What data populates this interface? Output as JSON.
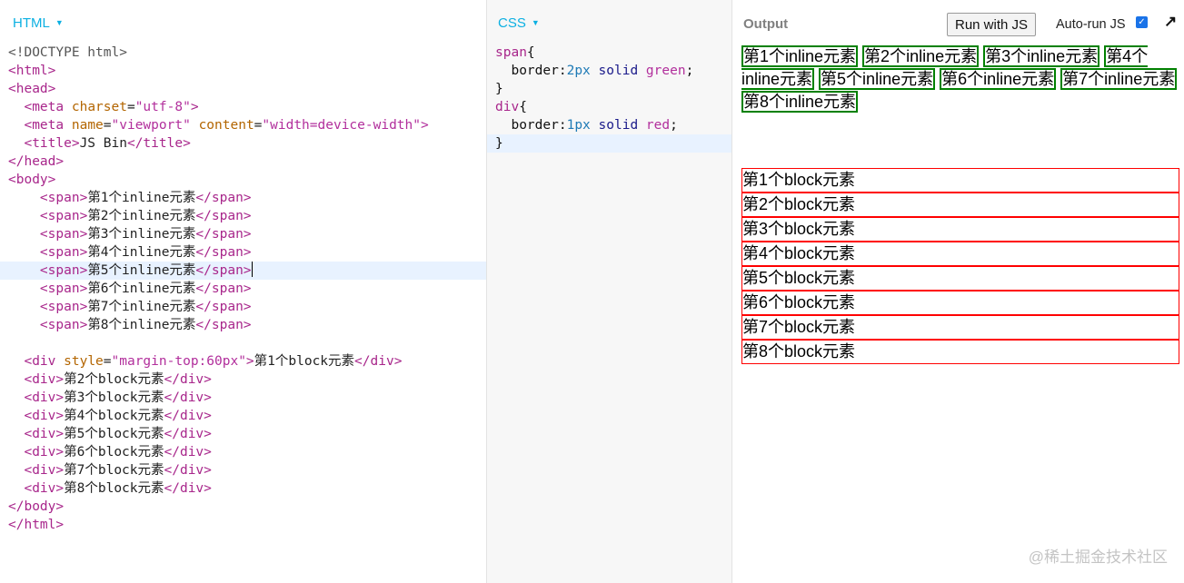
{
  "html_panel": {
    "title": "HTML",
    "lines": [
      [
        [
          "doc",
          "<!DOCTYPE html>"
        ]
      ],
      [
        [
          "tag",
          "<html>"
        ]
      ],
      [
        [
          "tag",
          "<head>"
        ]
      ],
      [
        [
          "sp",
          "  "
        ],
        [
          "tag",
          "<meta "
        ],
        [
          "attr",
          "charset"
        ],
        [
          "txt",
          "="
        ],
        [
          "val",
          "\"utf-8\""
        ],
        [
          "tag",
          ">"
        ]
      ],
      [
        [
          "sp",
          "  "
        ],
        [
          "tag",
          "<meta "
        ],
        [
          "attr",
          "name"
        ],
        [
          "txt",
          "="
        ],
        [
          "val",
          "\"viewport\""
        ],
        [
          "txt",
          " "
        ],
        [
          "attr",
          "content"
        ],
        [
          "txt",
          "="
        ],
        [
          "val",
          "\"width=device-width\">"
        ]
      ],
      [
        [
          "sp",
          "  "
        ],
        [
          "tag",
          "<title>"
        ],
        [
          "txt",
          "JS Bin"
        ],
        [
          "tag",
          "</title>"
        ]
      ],
      [
        [
          "tag",
          "</head>"
        ]
      ],
      [
        [
          "tag",
          "<body>"
        ]
      ],
      [
        [
          "sp",
          "    "
        ],
        [
          "tag",
          "<span>"
        ],
        [
          "txt",
          "第1个inline元素"
        ],
        [
          "tag",
          "</span>"
        ]
      ],
      [
        [
          "sp",
          "    "
        ],
        [
          "tag",
          "<span>"
        ],
        [
          "txt",
          "第2个inline元素"
        ],
        [
          "tag",
          "</span>"
        ]
      ],
      [
        [
          "sp",
          "    "
        ],
        [
          "tag",
          "<span>"
        ],
        [
          "txt",
          "第3个inline元素"
        ],
        [
          "tag",
          "</span>"
        ]
      ],
      [
        [
          "sp",
          "    "
        ],
        [
          "tag",
          "<span>"
        ],
        [
          "txt",
          "第4个inline元素"
        ],
        [
          "tag",
          "</span>"
        ]
      ],
      [
        [
          "sp",
          "    "
        ],
        [
          "tag",
          "<span>"
        ],
        [
          "txt",
          "第5个inline元素"
        ],
        [
          "tag",
          "</span>"
        ],
        [
          "cursor",
          ""
        ]
      ],
      [
        [
          "sp",
          "    "
        ],
        [
          "tag",
          "<span>"
        ],
        [
          "txt",
          "第6个inline元素"
        ],
        [
          "tag",
          "</span>"
        ]
      ],
      [
        [
          "sp",
          "    "
        ],
        [
          "tag",
          "<span>"
        ],
        [
          "txt",
          "第7个inline元素"
        ],
        [
          "tag",
          "</span>"
        ]
      ],
      [
        [
          "sp",
          "    "
        ],
        [
          "tag",
          "<span>"
        ],
        [
          "txt",
          "第8个inline元素"
        ],
        [
          "tag",
          "</span>"
        ]
      ],
      [],
      [
        [
          "sp",
          "  "
        ],
        [
          "tag",
          "<div "
        ],
        [
          "attr",
          "style"
        ],
        [
          "txt",
          "="
        ],
        [
          "val",
          "\"margin-top:60px\""
        ],
        [
          "tag",
          ">"
        ],
        [
          "txt",
          "第1个block元素"
        ],
        [
          "tag",
          "</div>"
        ]
      ],
      [
        [
          "sp",
          "  "
        ],
        [
          "tag",
          "<div>"
        ],
        [
          "txt",
          "第2个block元素"
        ],
        [
          "tag",
          "</div>"
        ]
      ],
      [
        [
          "sp",
          "  "
        ],
        [
          "tag",
          "<div>"
        ],
        [
          "txt",
          "第3个block元素"
        ],
        [
          "tag",
          "</div>"
        ]
      ],
      [
        [
          "sp",
          "  "
        ],
        [
          "tag",
          "<div>"
        ],
        [
          "txt",
          "第4个block元素"
        ],
        [
          "tag",
          "</div>"
        ]
      ],
      [
        [
          "sp",
          "  "
        ],
        [
          "tag",
          "<div>"
        ],
        [
          "txt",
          "第5个block元素"
        ],
        [
          "tag",
          "</div>"
        ]
      ],
      [
        [
          "sp",
          "  "
        ],
        [
          "tag",
          "<div>"
        ],
        [
          "txt",
          "第6个block元素"
        ],
        [
          "tag",
          "</div>"
        ]
      ],
      [
        [
          "sp",
          "  "
        ],
        [
          "tag",
          "<div>"
        ],
        [
          "txt",
          "第7个block元素"
        ],
        [
          "tag",
          "</div>"
        ]
      ],
      [
        [
          "sp",
          "  "
        ],
        [
          "tag",
          "<div>"
        ],
        [
          "txt",
          "第8个block元素"
        ],
        [
          "tag",
          "</div>"
        ]
      ],
      [
        [
          "tag",
          "</body>"
        ]
      ],
      [
        [
          "tag",
          "</html>"
        ]
      ]
    ],
    "active_line": 12
  },
  "css_panel": {
    "title": "CSS",
    "lines": [
      [
        [
          "sel",
          "span"
        ],
        [
          "pun",
          "{"
        ]
      ],
      [
        [
          "sp",
          "  "
        ],
        [
          "prop",
          "border"
        ],
        [
          "pun",
          ":"
        ],
        [
          "num",
          "2px"
        ],
        [
          "kw",
          " solid "
        ],
        [
          "val",
          "green"
        ],
        [
          "pun",
          ";"
        ]
      ],
      [
        [
          "pun",
          "}"
        ]
      ],
      [
        [
          "sel",
          "div"
        ],
        [
          "pun",
          "{"
        ]
      ],
      [
        [
          "sp",
          "  "
        ],
        [
          "prop",
          "border"
        ],
        [
          "pun",
          ":"
        ],
        [
          "num",
          "1px"
        ],
        [
          "kw",
          " solid "
        ],
        [
          "val",
          "red"
        ],
        [
          "pun",
          ";"
        ]
      ],
      [
        [
          "pun",
          "}"
        ]
      ]
    ],
    "active_line": 5
  },
  "output_panel": {
    "title": "Output",
    "run_button": "Run with JS",
    "autorun_label": "Auto-run JS",
    "autorun_checked": true,
    "inline_items": [
      "第1个inline元素",
      "第2个inline元素",
      "第3个inline元素",
      "第4个inline元素",
      "第5个inline元素",
      "第6个inline元素",
      "第7个inline元素",
      "第8个inline元素"
    ],
    "block_items": [
      "第1个block元素",
      "第2个block元素",
      "第3个block元素",
      "第4个block元素",
      "第5个block元素",
      "第6个block元素",
      "第7个block元素",
      "第8个block元素"
    ]
  },
  "watermark": "@稀土掘金技术社区",
  "colors": {
    "panel_title": "#0cb0e2",
    "inline_border": "green",
    "block_border": "red",
    "active_line": "#e8f2ff"
  }
}
